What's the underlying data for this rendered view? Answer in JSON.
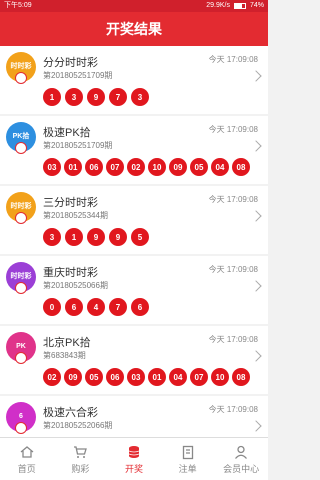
{
  "statusbar": {
    "time": "下午5:09",
    "speed": "29.9K/s",
    "battery": "74%"
  },
  "header": {
    "title": "开奖结果"
  },
  "lotteries": [
    {
      "logo_text": "时时彩",
      "logo_color": "#f2a11a",
      "name": "分分时时彩",
      "time": "今天 17:09:08",
      "period": "第201805251709期",
      "balls": [
        "1",
        "3",
        "9",
        "7",
        "3"
      ]
    },
    {
      "logo_text": "PK拾",
      "logo_color": "#2d8fe0",
      "name": "极速PK拾",
      "time": "今天 17:09:08",
      "period": "第201805251709期",
      "balls": [
        "03",
        "01",
        "06",
        "07",
        "02",
        "10",
        "09",
        "05",
        "04",
        "08"
      ]
    },
    {
      "logo_text": "时时彩",
      "logo_color": "#f2a11a",
      "name": "三分时时彩",
      "time": "今天 17:09:08",
      "period": "第20180525344期",
      "balls": [
        "3",
        "1",
        "9",
        "9",
        "5"
      ]
    },
    {
      "logo_text": "时时彩",
      "logo_color": "#9b3fd6",
      "name": "重庆时时彩",
      "time": "今天 17:09:08",
      "period": "第20180525066期",
      "balls": [
        "0",
        "6",
        "4",
        "7",
        "6"
      ]
    },
    {
      "logo_text": "PK",
      "logo_color": "#e0338a",
      "name": "北京PK拾",
      "time": "今天 17:09:08",
      "period": "第683843期",
      "balls": [
        "02",
        "09",
        "05",
        "06",
        "03",
        "01",
        "04",
        "07",
        "10",
        "08"
      ]
    },
    {
      "logo_text": "6",
      "logo_color": "#d02fc8",
      "name": "极速六合彩",
      "time": "今天 17:09:08",
      "period": "第201805252066期",
      "balls": [
        "",
        "",
        "",
        "",
        "",
        ""
      ]
    }
  ],
  "tabbar": {
    "tabs": [
      {
        "label": "首页",
        "icon": "home-icon"
      },
      {
        "label": "购彩",
        "icon": "cart-icon"
      },
      {
        "label": "开奖",
        "icon": "coins-icon"
      },
      {
        "label": "注单",
        "icon": "clipboard-icon"
      },
      {
        "label": "会员中心",
        "icon": "user-icon"
      }
    ]
  }
}
